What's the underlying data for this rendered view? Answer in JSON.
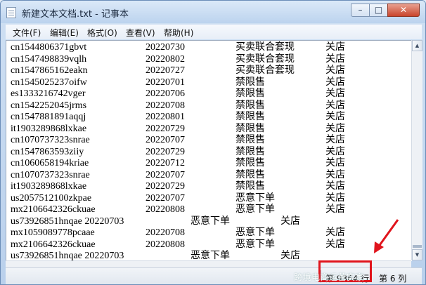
{
  "window": {
    "title": "新建文本文档.txt - 记事本",
    "icon": "notepad-icon"
  },
  "controls": {
    "minimize": "–",
    "maximize": "□",
    "close": "✕"
  },
  "menu": [
    "文件(F)",
    "编辑(E)",
    "格式(O)",
    "查看(V)",
    "帮助(H)"
  ],
  "lines": [
    {
      "id": "cn1544806371gbvt",
      "date": "20220730",
      "reason": "买卖联合套现",
      "action": "关店"
    },
    {
      "id": "cn1547498839vqlh",
      "date": "20220802",
      "reason": "买卖联合套现",
      "action": "关店"
    },
    {
      "id": "cn1547865162eakn",
      "date": "20220727",
      "reason": "买卖联合套现",
      "action": "关店"
    },
    {
      "id": "cn1545025237oifw",
      "date": "20220701",
      "reason": "禁限售",
      "action": "关店"
    },
    {
      "id": "es1333216742vger",
      "date": "20220706",
      "reason": "禁限售",
      "action": "关店"
    },
    {
      "id": "cn1542252045jrms",
      "date": "20220708",
      "reason": "禁限售",
      "action": "关店"
    },
    {
      "id": "cn1547881891aqqj",
      "date": "20220801",
      "reason": "禁限售",
      "action": "关店"
    },
    {
      "id": "it1903289868lxkae",
      "date": "20220729",
      "reason": "禁限售",
      "action": "关店"
    },
    {
      "id": "cn1070737323snrae",
      "date": "20220707",
      "reason": "禁限售",
      "action": "关店"
    },
    {
      "id": "cn1547863593ziiy",
      "date": "20220729",
      "reason": "禁限售",
      "action": "关店"
    },
    {
      "id": "cn1060658194kriae",
      "date": "20220712",
      "reason": "禁限售",
      "action": "关店"
    },
    {
      "id": "cn1070737323snrae",
      "date": "20220707",
      "reason": "禁限售",
      "action": "关店"
    },
    {
      "id": "it1903289868lxkae",
      "date": "20220729",
      "reason": "禁限售",
      "action": "关店"
    },
    {
      "id": "us2057512100zkpae",
      "date": "20220707",
      "reason": "恶意下单",
      "action": "关店"
    },
    {
      "id": "mx2106642326ckuae",
      "date": "20220808",
      "reason": "恶意下单",
      "action": "关店"
    },
    {
      "id": "us73926851hnqae 20220703",
      "date": "",
      "reason": "恶意下单",
      "action": "关店"
    },
    {
      "id": "mx1059089778pcaae",
      "date": "20220708",
      "reason": "恶意下单",
      "action": "关店"
    },
    {
      "id": "mx2106642326ckuae",
      "date": "20220808",
      "reason": "恶意下单",
      "action": "关店"
    },
    {
      "id": "us73926851hnqae 20220703",
      "date": "",
      "reason": "恶意下单",
      "action": "关店"
    }
  ],
  "status": {
    "position": "第 9364 行",
    "column": "第 6 列"
  },
  "watermark": "跨境电商运营实家",
  "colors": {
    "highlight": "#e0141c"
  }
}
